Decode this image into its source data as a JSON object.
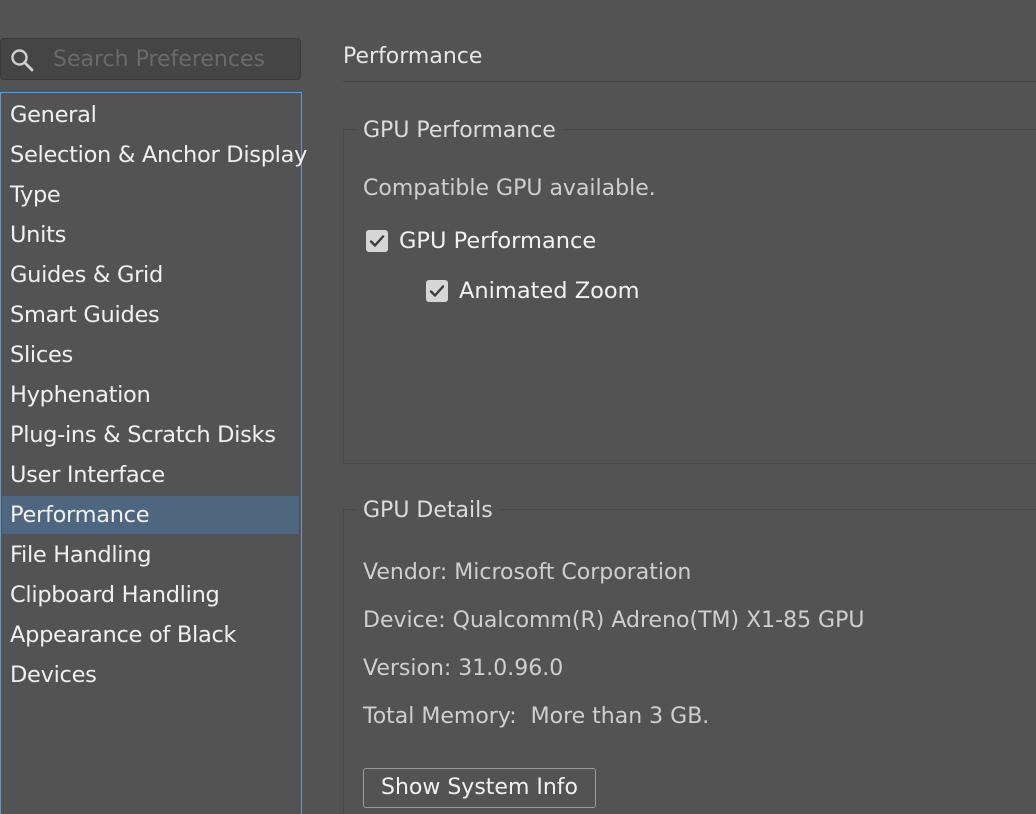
{
  "search": {
    "placeholder": "Search Preferences",
    "icon": "search-icon"
  },
  "categories": [
    {
      "label": "General"
    },
    {
      "label": "Selection & Anchor Display"
    },
    {
      "label": "Type"
    },
    {
      "label": "Units"
    },
    {
      "label": "Guides & Grid"
    },
    {
      "label": "Smart Guides"
    },
    {
      "label": "Slices"
    },
    {
      "label": "Hyphenation"
    },
    {
      "label": "Plug-ins & Scratch Disks"
    },
    {
      "label": "User Interface"
    },
    {
      "label": "Performance"
    },
    {
      "label": "File Handling"
    },
    {
      "label": "Clipboard Handling"
    },
    {
      "label": "Appearance of Black"
    },
    {
      "label": "Devices"
    }
  ],
  "selected_category": "Performance",
  "main": {
    "title": "Performance",
    "gpu_performance": {
      "group_label": "GPU Performance",
      "status": "Compatible GPU available.",
      "gpu_performance_checkbox": {
        "label": "GPU Performance",
        "checked": true
      },
      "animated_zoom_checkbox": {
        "label": "Animated Zoom",
        "checked": true
      }
    },
    "gpu_details": {
      "group_label": "GPU Details",
      "vendor": "Vendor: Microsoft Corporation",
      "device": "Device: Qualcomm(R) Adreno(TM) X1-85 GPU",
      "version": "Version: 31.0.96.0",
      "total_memory": "Total Memory:  More than 3 GB.",
      "show_system_info_label": "Show System Info"
    }
  },
  "colors": {
    "background": "#535353",
    "selection": "#4e6680",
    "list_border": "#6a98c8"
  }
}
